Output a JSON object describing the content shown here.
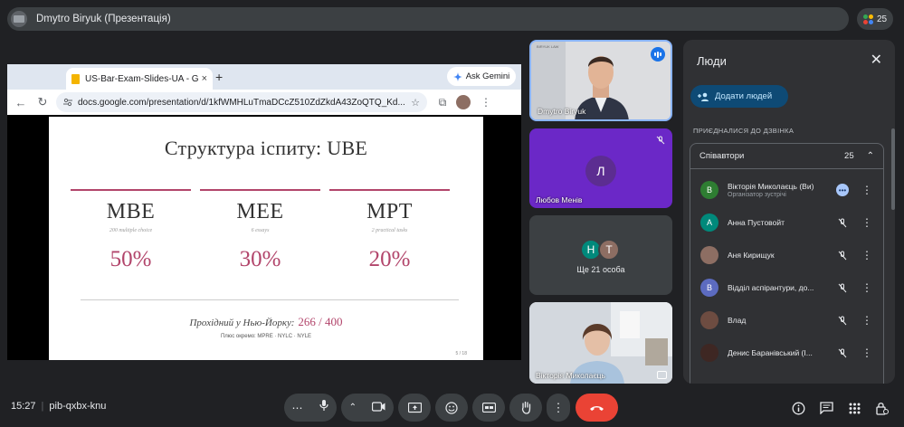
{
  "topbar": {
    "presenter_label": "Dmytro Biryuk (Презентація)",
    "people_count": "25"
  },
  "browser": {
    "tab_title": "US-Bar-Exam-Slides-UA - Go",
    "tab_close": "×",
    "new_tab": "+",
    "ask_gemini": "Ask Gemini",
    "url": "docs.google.com/presentation/d/1kfWMHLuTmaDCcZ510ZdZkdA43ZoQTQ_Kd..."
  },
  "slide": {
    "title": "Структура іспиту: UBE",
    "columns": [
      {
        "code": "MBE",
        "sub": "200 multiple choice",
        "pct": "50%"
      },
      {
        "code": "MEE",
        "sub": "6 essays",
        "pct": "30%"
      },
      {
        "code": "MPT",
        "sub": "2 practical tasks",
        "pct": "20%"
      }
    ],
    "passing_label": "Прохідний у Нью-Йорку:",
    "passing_score": "266 / 400",
    "plus_line": "Плюс окремо:  MPRE  ·  NYLC  ·  NYLE",
    "page": "5 / 18"
  },
  "tiles": [
    {
      "name": "Dmytro Biryuk",
      "header_tiny": "BIRYUK LAW"
    },
    {
      "name": "Любов Менів",
      "initial": "Л"
    },
    {
      "label": "Ще 21 особа",
      "initials": [
        "Н",
        "Т"
      ]
    },
    {
      "name": "Вікторія Миколаєць"
    }
  ],
  "panel": {
    "title": "Люди",
    "close": "✕",
    "add_people": "Додати людей",
    "joined_label": "ПРИЄДНАЛИСЯ ДО ДЗВІНКА",
    "group_label": "Співавтори",
    "group_count": "25",
    "participants": [
      {
        "initial": "В",
        "name": "Вікторія Миколаєць (Ви)",
        "role": "Організатор зустрічі",
        "color": "#2e7d32"
      },
      {
        "initial": "А",
        "name": "Анна Пустовойт",
        "role": "",
        "color": "#00897b"
      },
      {
        "initial": "",
        "name": "Аня Кирищук",
        "role": "",
        "color": "#8d6e63"
      },
      {
        "initial": "В",
        "name": "Відділ аспірантури, до...",
        "role": "",
        "color": "#5c6bc0"
      },
      {
        "initial": "",
        "name": "Влад",
        "role": "",
        "color": "#6d4c41"
      },
      {
        "initial": "",
        "name": "Денис Баранівський (І...",
        "role": "",
        "color": "#3e2723"
      }
    ]
  },
  "bottom": {
    "time": "15:27",
    "meeting_code": "pib-qxbx-knu"
  },
  "colors": {
    "accent": "#b2456b",
    "leave": "#ea4335",
    "speaking": "#1a73e8",
    "tile_purple": "#6b28c7"
  }
}
